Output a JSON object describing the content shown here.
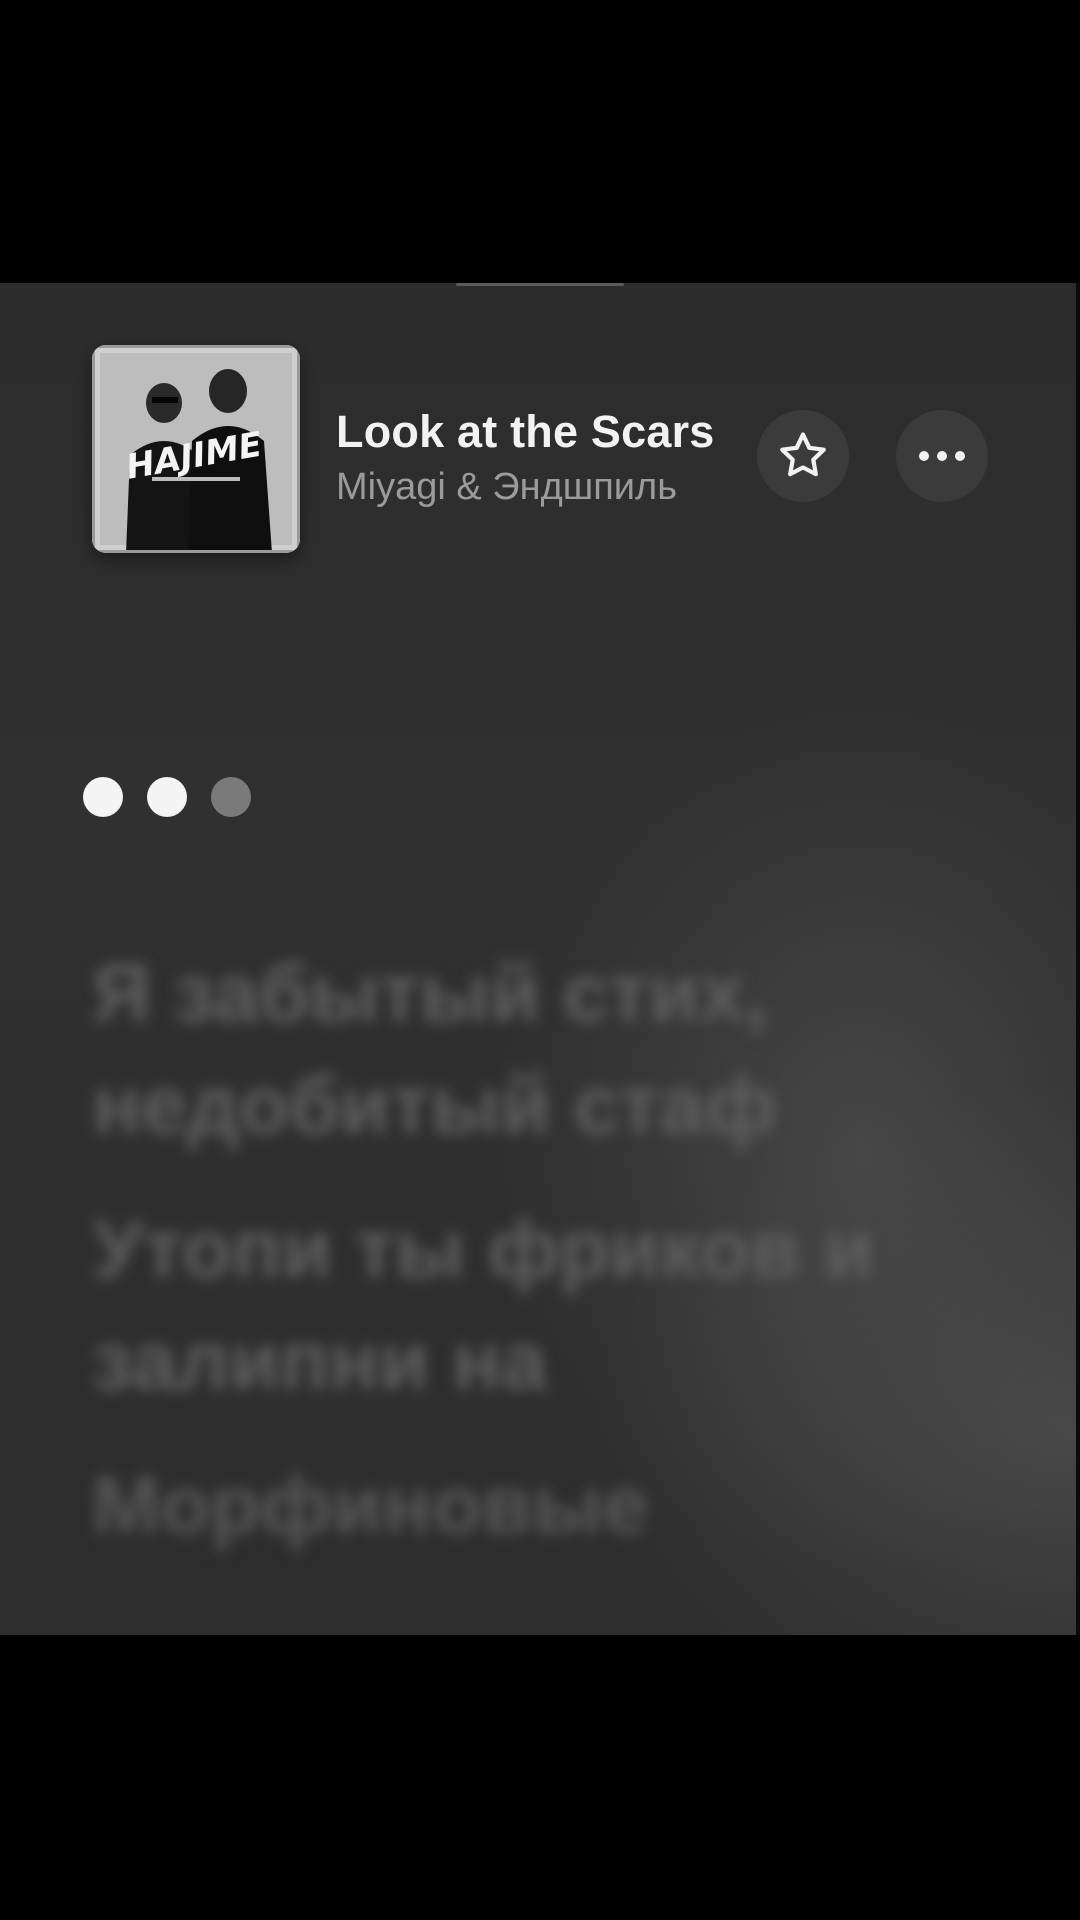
{
  "now_playing": {
    "title": "Look at the Scars",
    "artist": "Miyagi & Эндшпиль",
    "cover_text": "HAJIME",
    "favorite_icon": "star-outline-icon",
    "more_icon": "ellipsis-icon"
  },
  "progress": {
    "dots_active": 2,
    "dots_total": 3
  },
  "lyrics": [
    "Я забытый стих, недобитый стаф",
    "Утопи ты фриков и залипни на",
    "Морфиновые"
  ],
  "colors": {
    "background": "#2e2e2e",
    "title": "#f2f2f2",
    "artist": "#9b9b9b",
    "button_bg": "#3b3b3b"
  }
}
